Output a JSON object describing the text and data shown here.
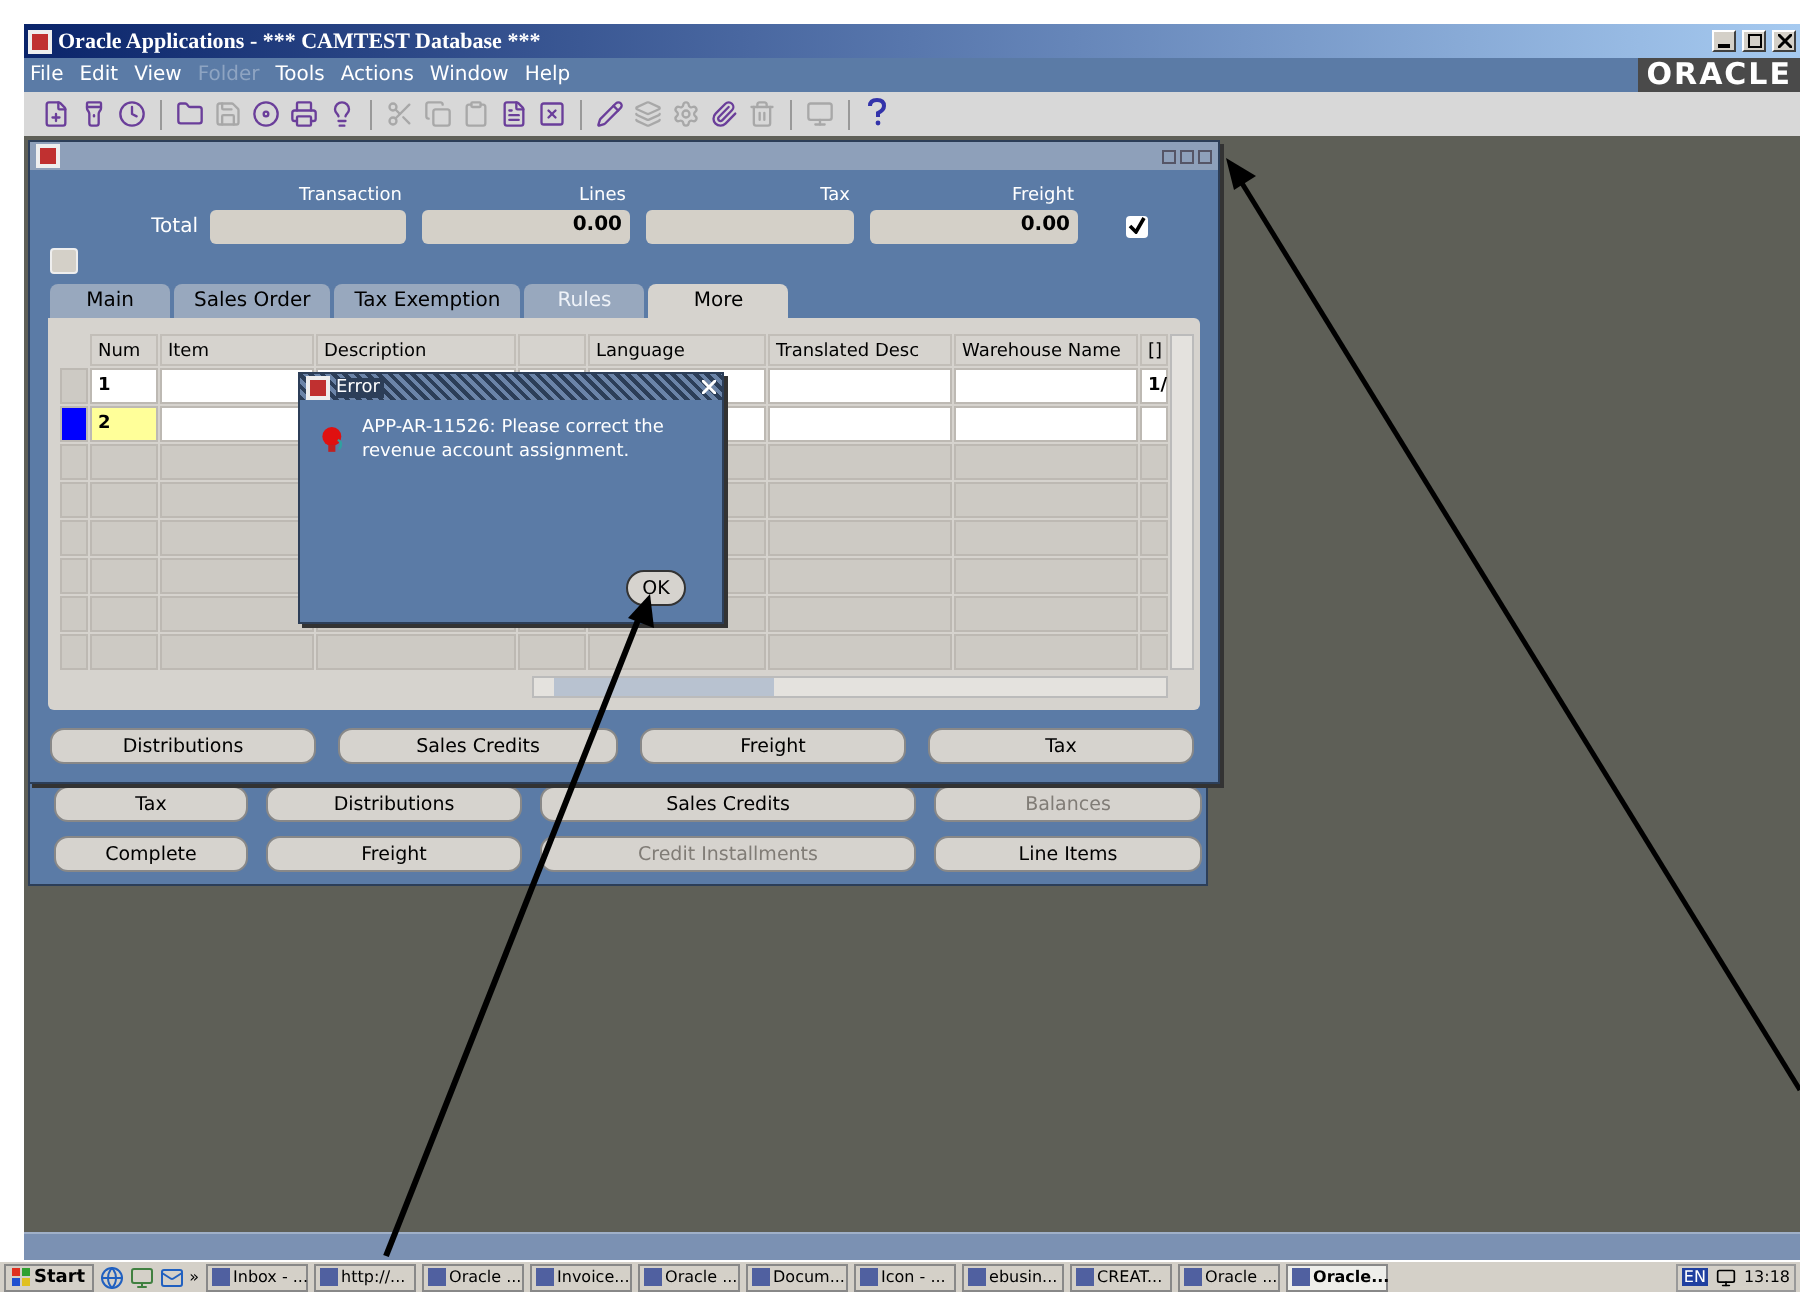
{
  "window": {
    "title": "Oracle Applications - *** CAMTEST Database ***",
    "logo": "ORACLE"
  },
  "menu": [
    {
      "label": "File",
      "disabled": false
    },
    {
      "label": "Edit",
      "disabled": false
    },
    {
      "label": "View",
      "disabled": false
    },
    {
      "label": "Folder",
      "disabled": true
    },
    {
      "label": "Tools",
      "disabled": false
    },
    {
      "label": "Actions",
      "disabled": false
    },
    {
      "label": "Window",
      "disabled": false
    },
    {
      "label": "Help",
      "disabled": false
    }
  ],
  "toolbar": [
    {
      "kind": "button",
      "disabled": false
    },
    {
      "kind": "button",
      "disabled": false
    },
    {
      "kind": "button",
      "disabled": false
    },
    {
      "kind": "separator"
    },
    {
      "kind": "button",
      "disabled": false
    },
    {
      "kind": "button",
      "disabled": true
    },
    {
      "kind": "button",
      "disabled": false
    },
    {
      "kind": "button",
      "disabled": false
    },
    {
      "kind": "button",
      "disabled": false
    },
    {
      "kind": "separator"
    },
    {
      "kind": "button",
      "disabled": true
    },
    {
      "kind": "button",
      "disabled": true
    },
    {
      "kind": "button",
      "disabled": true
    },
    {
      "kind": "button",
      "disabled": false
    },
    {
      "kind": "button",
      "disabled": false
    },
    {
      "kind": "separator"
    },
    {
      "kind": "button",
      "disabled": false
    },
    {
      "kind": "button",
      "disabled": true
    },
    {
      "kind": "button",
      "disabled": true
    },
    {
      "kind": "button",
      "disabled": false
    },
    {
      "kind": "button",
      "disabled": true
    },
    {
      "kind": "separator"
    },
    {
      "kind": "button",
      "disabled": true
    },
    {
      "kind": "separator"
    },
    {
      "kind": "help",
      "disabled": false
    }
  ],
  "form": {
    "totals": {
      "label": "Total",
      "columns": [
        {
          "heading": "Transaction"
        },
        {
          "heading": "Lines",
          "value": "0.00"
        },
        {
          "heading": "Tax"
        },
        {
          "heading": "Freight",
          "value": "0.00"
        }
      ],
      "checked": true
    },
    "tabs": [
      {
        "label": "Main",
        "selected": false,
        "disabled": false
      },
      {
        "label": "Sales Order",
        "selected": false,
        "disabled": false
      },
      {
        "label": "Tax Exemption",
        "selected": false,
        "disabled": false
      },
      {
        "label": "Rules",
        "selected": false,
        "disabled": true
      },
      {
        "label": "More",
        "selected": true,
        "disabled": false
      }
    ],
    "grid": {
      "columns": [
        {
          "label": "Num"
        },
        {
          "label": "Item"
        },
        {
          "label": "Description"
        },
        {},
        {
          "label": "Language"
        },
        {
          "label": "Translated Desc"
        },
        {
          "label": "Warehouse Name"
        },
        {
          "label": "[]"
        }
      ],
      "rows": [
        {
          "kind": "entered",
          "current": false,
          "num": "1",
          "column_8": "1/"
        },
        {
          "kind": "entered",
          "current": true,
          "num": "2"
        },
        {
          "kind": "empty",
          "current": false
        },
        {
          "kind": "empty",
          "current": false
        },
        {
          "kind": "empty",
          "current": false
        },
        {
          "kind": "empty",
          "current": false
        },
        {
          "kind": "empty",
          "current": false
        },
        {
          "kind": "empty",
          "current": false
        }
      ]
    },
    "buttons": [
      {
        "label": "Distributions",
        "disabled": false
      },
      {
        "label": "Sales Credits",
        "disabled": false
      },
      {
        "label": "Freight",
        "disabled": false
      },
      {
        "label": "Tax",
        "disabled": false
      }
    ]
  },
  "dialog": {
    "title": "Error",
    "message": "APP-AR-11526: Please correct the revenue account assignment.",
    "button": "OK"
  },
  "background_buttons": [
    [
      {
        "label": "Tax",
        "disabled": false
      },
      {
        "label": "Distributions",
        "disabled": false
      },
      {
        "label": "Sales Credits",
        "disabled": false
      },
      {
        "label": "Balances",
        "disabled": true
      }
    ],
    [
      {
        "label": "Complete",
        "disabled": false
      },
      {
        "label": "Freight",
        "disabled": false
      },
      {
        "label": "Credit Installments",
        "disabled": true
      },
      {
        "label": "Line Items",
        "disabled": false
      }
    ]
  ],
  "taskbar": {
    "start": "Start",
    "overflow": "»",
    "tasks": [
      {
        "label": "Inbox - ...",
        "selected": false
      },
      {
        "label": "http://...",
        "selected": false
      },
      {
        "label": "Oracle ...",
        "selected": false
      },
      {
        "label": "Invoice...",
        "selected": false
      },
      {
        "label": "Oracle ...",
        "selected": false
      },
      {
        "label": "Docum...",
        "selected": false
      },
      {
        "label": "Icon - ...",
        "selected": false
      },
      {
        "label": "ebusin...",
        "selected": false
      },
      {
        "label": "CREAT...",
        "selected": false
      },
      {
        "label": "Oracle ...",
        "selected": false
      },
      {
        "label": "Oracle...",
        "selected": true
      }
    ],
    "language": "EN",
    "time": "13:18"
  }
}
